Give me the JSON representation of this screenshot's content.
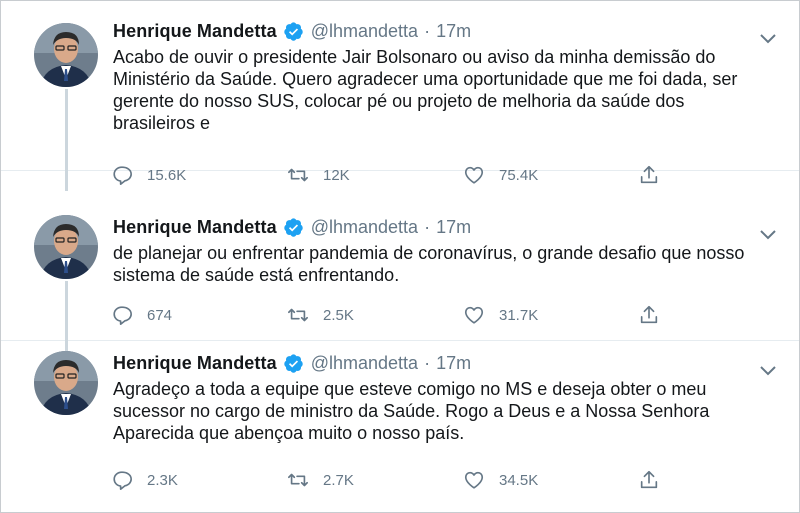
{
  "colors": {
    "verified": "#1da1f2",
    "text": "#14171a",
    "muted": "#657786",
    "thread": "#ccd6dd"
  },
  "tweets": [
    {
      "name": "Henrique Mandetta",
      "handle": "@lhmandetta",
      "dot": "·",
      "time": "17m",
      "text": "Acabo de ouvir o presidente Jair Bolsonaro ou aviso da minha demissão do Ministério da Saúde. Quero agradecer uma oportunidade que me foi dada, ser gerente do nosso SUS, colocar pé ou projeto de melhoria da saúde dos brasileiros e",
      "replies": "15.6K",
      "retweets": "12K",
      "likes": "75.4K",
      "icons": [
        "reply-icon",
        "retweet-icon",
        "like-icon",
        "share-icon",
        "verified-icon",
        "chevron-down-icon"
      ]
    },
    {
      "name": "Henrique Mandetta",
      "handle": "@lhmandetta",
      "dot": "·",
      "time": "17m",
      "text": "de planejar ou enfrentar pandemia de coronavírus, o grande desafio que nosso sistema de saúde está enfrentando.",
      "replies": "674",
      "retweets": "2.5K",
      "likes": "31.7K"
    },
    {
      "name": "Henrique Mandetta",
      "handle": "@lhmandetta",
      "dot": "·",
      "time": "17m",
      "text": "Agradeço a toda a equipe que esteve comigo no MS e deseja obter o meu sucessor no cargo de ministro da Saúde. Rogo a Deus e a Nossa Senhora Aparecida que abençoa muito o nosso país.",
      "replies": "2.3K",
      "retweets": "2.7K",
      "likes": "34.5K"
    }
  ]
}
